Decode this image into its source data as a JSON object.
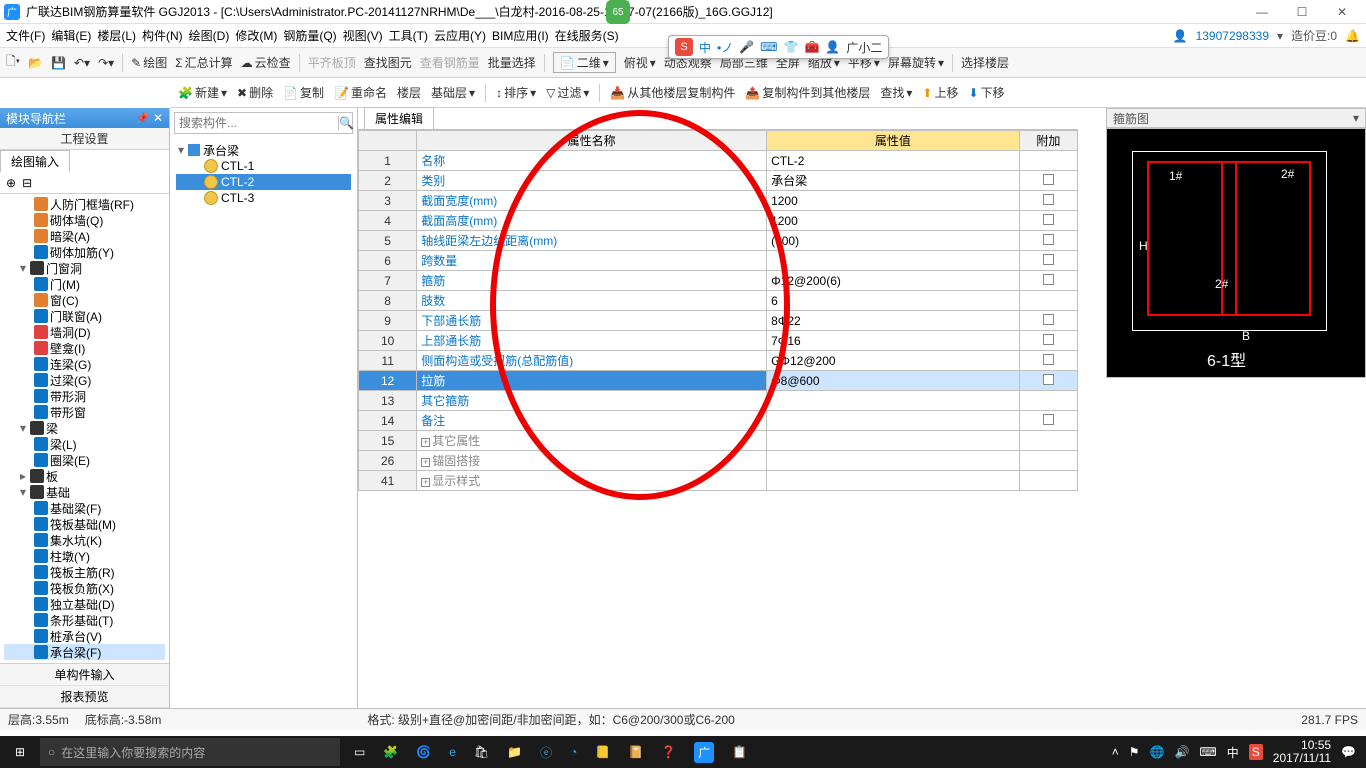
{
  "titlebar": {
    "title": "广联达BIM钢筋算量软件 GGJ2013 - [C:\\Users\\Administrator.PC-20141127NRHM\\De___\\白龙村-2016-08-25-13-27-07(2166版)_16G.GGJ12]",
    "page_badge": "65"
  },
  "menubar": {
    "items": [
      "文件(F)",
      "编辑(E)",
      "楼层(L)",
      "构件(N)",
      "绘图(D)",
      "修改(M)",
      "钢筋量(Q)",
      "视图(V)",
      "工具(T)",
      "云应用(Y)",
      "BIM应用(I)",
      "在线服务(S)"
    ],
    "right_account": "13907298339",
    "right_price_label": "造价豆:0",
    "right_user": "广小二"
  },
  "ime": {
    "mode": "中"
  },
  "toolbar1": {
    "drawing": "绘图",
    "sum_calc": "汇总计算",
    "cloud_check": "云检查",
    "flat_roof": "平齐板顶",
    "view_by": "查找图元",
    "view_steel": "查看钢筋量",
    "batch_sel": "批量选择",
    "dim": "二维",
    "overview": "俯视",
    "dyn_view": "动态观察",
    "local_3d": "局部三维",
    "fullscreen": "全屏",
    "zoom": "缩放",
    "pan": "平移",
    "screen_rotate": "屏幕旋转",
    "sel_floor": "选择楼层"
  },
  "toolbar2": {
    "new": "新建",
    "delete": "删除",
    "copy": "复制",
    "rename": "重命名",
    "floor": "楼层",
    "basic": "基础层",
    "sort": "排序",
    "filter": "过滤",
    "copy_from": "从其他楼层复制构件",
    "copy_to": "复制构件到其他楼层",
    "find": "查找",
    "up": "上移",
    "down": "下移"
  },
  "nav": {
    "header": "模块导航栏",
    "eng_setting": "工程设置",
    "draw_input": "绘图输入",
    "single_input": "单构件输入",
    "report_preview": "报表预览",
    "items": [
      {
        "lbl": "人防门框墙(RF)",
        "pad": 30,
        "color": "#e08030"
      },
      {
        "lbl": "砌体墙(Q)",
        "pad": 30,
        "color": "#e08030"
      },
      {
        "lbl": "暗梁(A)",
        "pad": 30,
        "color": "#e08030"
      },
      {
        "lbl": "砌体加筋(Y)",
        "pad": 30,
        "color": "#0b74c4"
      },
      {
        "lbl": "门窗洞",
        "pad": 16,
        "color": "#333",
        "exp": "▾"
      },
      {
        "lbl": "门(M)",
        "pad": 30,
        "color": "#0b74c4"
      },
      {
        "lbl": "窗(C)",
        "pad": 30,
        "color": "#e08030"
      },
      {
        "lbl": "门联窗(A)",
        "pad": 30,
        "color": "#0b74c4"
      },
      {
        "lbl": "墙洞(D)",
        "pad": 30,
        "color": "#e04040"
      },
      {
        "lbl": "壁龛(I)",
        "pad": 30,
        "color": "#e04040"
      },
      {
        "lbl": "连梁(G)",
        "pad": 30,
        "color": "#0b74c4"
      },
      {
        "lbl": "过梁(G)",
        "pad": 30,
        "color": "#0b74c4"
      },
      {
        "lbl": "带形洞",
        "pad": 30,
        "color": "#0b74c4"
      },
      {
        "lbl": "带形窗",
        "pad": 30,
        "color": "#0b74c4"
      },
      {
        "lbl": "梁",
        "pad": 16,
        "color": "#333",
        "exp": "▾"
      },
      {
        "lbl": "梁(L)",
        "pad": 30,
        "color": "#0b74c4"
      },
      {
        "lbl": "圈梁(E)",
        "pad": 30,
        "color": "#0b74c4"
      },
      {
        "lbl": "板",
        "pad": 16,
        "color": "#333",
        "exp": "▸"
      },
      {
        "lbl": "基础",
        "pad": 16,
        "color": "#333",
        "exp": "▾"
      },
      {
        "lbl": "基础梁(F)",
        "pad": 30,
        "color": "#0b74c4"
      },
      {
        "lbl": "筏板基础(M)",
        "pad": 30,
        "color": "#0b74c4"
      },
      {
        "lbl": "集水坑(K)",
        "pad": 30,
        "color": "#0b74c4"
      },
      {
        "lbl": "柱墩(Y)",
        "pad": 30,
        "color": "#0b74c4"
      },
      {
        "lbl": "筏板主筋(R)",
        "pad": 30,
        "color": "#0b74c4"
      },
      {
        "lbl": "筏板负筋(X)",
        "pad": 30,
        "color": "#0b74c4"
      },
      {
        "lbl": "独立基础(D)",
        "pad": 30,
        "color": "#0b74c4"
      },
      {
        "lbl": "条形基础(T)",
        "pad": 30,
        "color": "#0b74c4"
      },
      {
        "lbl": "桩承台(V)",
        "pad": 30,
        "color": "#0b74c4"
      },
      {
        "lbl": "承台梁(F)",
        "pad": 30,
        "color": "#0b74c4",
        "sel": true
      }
    ]
  },
  "components": {
    "search_placeholder": "搜索构件...",
    "parent": "承台梁",
    "items": [
      {
        "name": "CTL-1"
      },
      {
        "name": "CTL-2",
        "sel": true
      },
      {
        "name": "CTL-3"
      }
    ]
  },
  "props": {
    "tab": "属性编辑",
    "headers": {
      "name": "属性名称",
      "value": "属性值",
      "add": "附加"
    },
    "rows": [
      {
        "n": "1",
        "name": "名称",
        "val": "CTL-2",
        "chk": false
      },
      {
        "n": "2",
        "name": "类别",
        "val": "承台梁",
        "chk": true
      },
      {
        "n": "3",
        "name": "截面宽度(mm)",
        "val": "1200",
        "chk": true
      },
      {
        "n": "4",
        "name": "截面高度(mm)",
        "val": "1200",
        "chk": true
      },
      {
        "n": "5",
        "name": "轴线距梁左边线距离(mm)",
        "val": "(600)",
        "chk": true
      },
      {
        "n": "6",
        "name": "跨数量",
        "val": "",
        "chk": true
      },
      {
        "n": "7",
        "name": "箍筋",
        "val": "Φ12@200(6)",
        "chk": true
      },
      {
        "n": "8",
        "name": "肢数",
        "val": "6",
        "chk": false
      },
      {
        "n": "9",
        "name": "下部通长筋",
        "val": "8Φ22",
        "chk": true
      },
      {
        "n": "10",
        "name": "上部通长筋",
        "val": "7Φ16",
        "chk": true
      },
      {
        "n": "11",
        "name": "侧面构造或受扭筋(总配筋值)",
        "val": "GΦ12@200",
        "chk": true
      },
      {
        "n": "12",
        "name": "拉筋",
        "val": "Φ8@600",
        "chk": true,
        "sel": true
      },
      {
        "n": "13",
        "name": "其它箍筋",
        "val": "",
        "chk": false
      },
      {
        "n": "14",
        "name": "备注",
        "val": "",
        "chk": true
      },
      {
        "n": "15",
        "name": "其它属性",
        "val": "",
        "gray": true,
        "exp": "+"
      },
      {
        "n": "26",
        "name": "锚固搭接",
        "val": "",
        "gray": true,
        "exp": "+"
      },
      {
        "n": "41",
        "name": "显示样式",
        "val": "",
        "gray": true,
        "exp": "+"
      }
    ]
  },
  "preview": {
    "title": "箍筋图",
    "labels": {
      "top_left": "1#",
      "top_right": "2#",
      "mid": "2#",
      "h": "H",
      "b": "B",
      "type": "6-1型"
    }
  },
  "statusbar": {
    "layer_h": "层高:3.55m",
    "bottom_h": "底标高:-3.58m",
    "format": "格式: 级别+直径@加密间距/非加密间距，如：C6@200/300或C6-200",
    "fps": "281.7 FPS"
  },
  "taskbar": {
    "search_placeholder": "在这里输入你要搜索的内容",
    "time": "10:55",
    "date": "2017/11/11"
  }
}
